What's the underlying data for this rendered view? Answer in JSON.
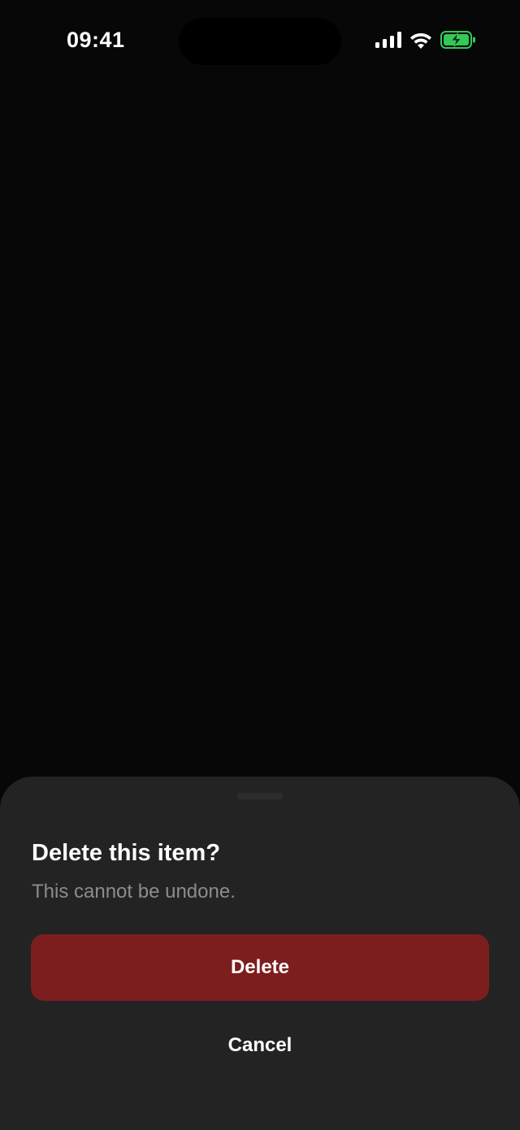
{
  "status_bar": {
    "time": "09:41",
    "icons": [
      "signal-icon",
      "wifi-icon",
      "battery-charging-icon"
    ],
    "battery_color": "#34c759"
  },
  "sheet": {
    "title": "Delete this item?",
    "message": "This cannot be undone.",
    "delete_label": "Delete",
    "cancel_label": "Cancel",
    "colors": {
      "background": "#232323",
      "destructive": "#7d1e1e",
      "message": "#8c8c8c"
    }
  }
}
